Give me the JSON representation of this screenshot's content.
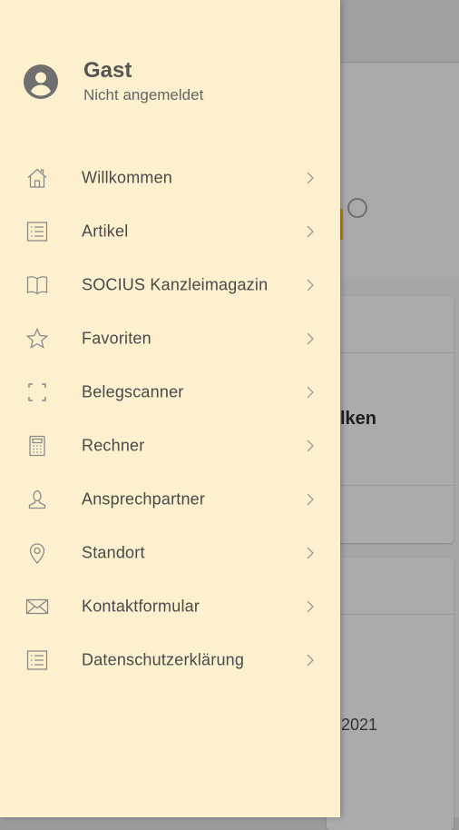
{
  "profile": {
    "name": "Gast",
    "status": "Nicht angemeldet"
  },
  "menu": [
    {
      "label": "Willkommen",
      "icon": "home-icon"
    },
    {
      "label": "Artikel",
      "icon": "list-icon"
    },
    {
      "label": "SOCIUS Kanzleimagazin",
      "icon": "book-icon"
    },
    {
      "label": "Favoriten",
      "icon": "star-icon"
    },
    {
      "label": "Belegscanner",
      "icon": "scan-frame-icon"
    },
    {
      "label": "Rechner",
      "icon": "calculator-icon"
    },
    {
      "label": "Ansprechpartner",
      "icon": "person-icon"
    },
    {
      "label": "Standort",
      "icon": "location-pin-icon"
    },
    {
      "label": "Kontaktformular",
      "icon": "envelope-icon"
    },
    {
      "label": "Datenschutzerklärung",
      "icon": "list-icon"
    }
  ],
  "background": {
    "card_title_fragment": "lken",
    "year_fragment": "2021"
  },
  "colors": {
    "drawer_background": "#fdf0cf",
    "text": "#4a4a4a",
    "icon": "#8a8a8a",
    "scrim": "#a6a6a6"
  }
}
